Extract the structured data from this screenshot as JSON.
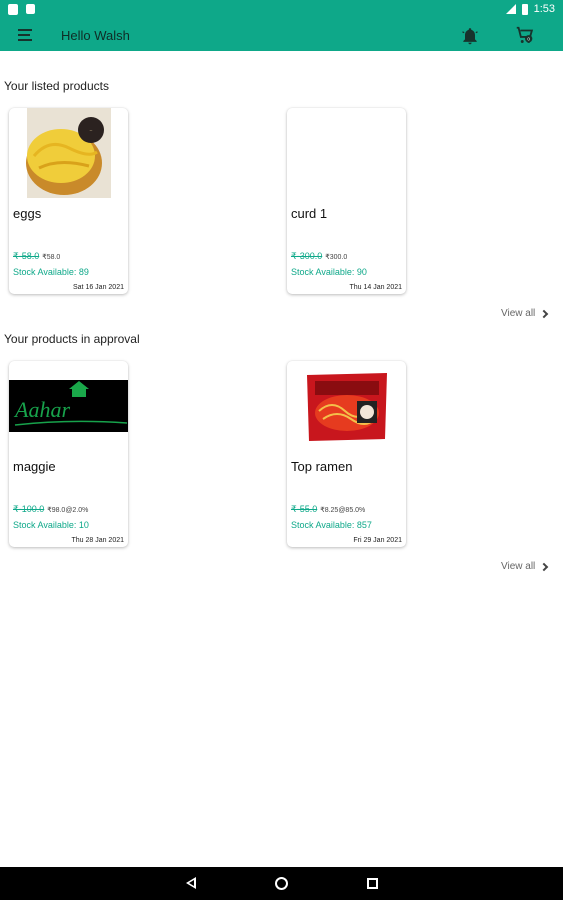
{
  "status_bar": {
    "time": "1:53"
  },
  "app_bar": {
    "title": "Hello Walsh"
  },
  "colors": {
    "primary": "#0ea889",
    "price": "#0ea889"
  },
  "sections": [
    {
      "title": "Your listed products",
      "view_all_label": "View all",
      "products": [
        {
          "name": "eggs",
          "price_old": "₹-58.0",
          "price_new": "₹58.0",
          "stock": "Stock Available: 89",
          "date": "Sat 16 Jan 2021",
          "image": "cake-photo"
        },
        {
          "name": "curd 1",
          "price_old": "₹-300.0",
          "price_new": "₹300.0",
          "stock": "Stock Available: 90",
          "date": "Thu 14 Jan 2021",
          "image": "blank"
        }
      ]
    },
    {
      "title": "Your products in approval",
      "view_all_label": "View all",
      "products": [
        {
          "name": "maggie",
          "price_old": "₹-100.0",
          "price_new": "₹98.0@2.0%",
          "stock": "Stock Available: 10",
          "date": "Thu 28 Jan 2021",
          "image": "aahar-logo"
        },
        {
          "name": "Top ramen",
          "price_old": "₹-55.0",
          "price_new": "₹8.25@85.0%",
          "stock": "Stock Available: 857",
          "date": "Fri 29 Jan 2021",
          "image": "ramen-pack"
        }
      ]
    }
  ],
  "icons": {
    "menu": "hamburger-menu-icon",
    "notifications": "bell-icon",
    "cart": "cart-icon",
    "back": "back-triangle-icon",
    "home": "home-circle-icon",
    "recents": "recents-square-icon"
  }
}
